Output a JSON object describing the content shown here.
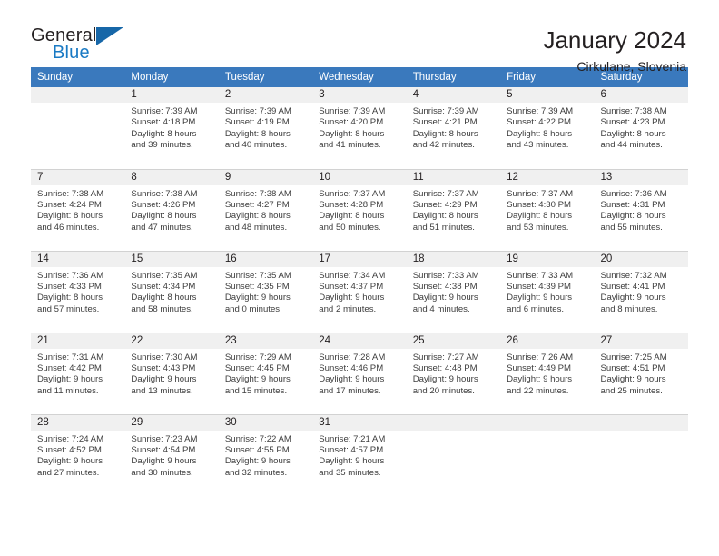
{
  "brand": {
    "name_part1": "General",
    "name_part2": "Blue",
    "accent_color": "#1a7ac4",
    "triangle_color": "#1767a8"
  },
  "header": {
    "title": "January 2024",
    "subtitle": "Cirkulane, Slovenia"
  },
  "calendar": {
    "header_bg": "#3a79bd",
    "daynum_bg": "#f0f0f0",
    "weekdays": [
      "Sunday",
      "Monday",
      "Tuesday",
      "Wednesday",
      "Thursday",
      "Friday",
      "Saturday"
    ],
    "weeks": [
      [
        {
          "day": "",
          "lines": []
        },
        {
          "day": "1",
          "lines": [
            "Sunrise: 7:39 AM",
            "Sunset: 4:18 PM",
            "Daylight: 8 hours",
            "and 39 minutes."
          ]
        },
        {
          "day": "2",
          "lines": [
            "Sunrise: 7:39 AM",
            "Sunset: 4:19 PM",
            "Daylight: 8 hours",
            "and 40 minutes."
          ]
        },
        {
          "day": "3",
          "lines": [
            "Sunrise: 7:39 AM",
            "Sunset: 4:20 PM",
            "Daylight: 8 hours",
            "and 41 minutes."
          ]
        },
        {
          "day": "4",
          "lines": [
            "Sunrise: 7:39 AM",
            "Sunset: 4:21 PM",
            "Daylight: 8 hours",
            "and 42 minutes."
          ]
        },
        {
          "day": "5",
          "lines": [
            "Sunrise: 7:39 AM",
            "Sunset: 4:22 PM",
            "Daylight: 8 hours",
            "and 43 minutes."
          ]
        },
        {
          "day": "6",
          "lines": [
            "Sunrise: 7:38 AM",
            "Sunset: 4:23 PM",
            "Daylight: 8 hours",
            "and 44 minutes."
          ]
        }
      ],
      [
        {
          "day": "7",
          "lines": [
            "Sunrise: 7:38 AM",
            "Sunset: 4:24 PM",
            "Daylight: 8 hours",
            "and 46 minutes."
          ]
        },
        {
          "day": "8",
          "lines": [
            "Sunrise: 7:38 AM",
            "Sunset: 4:26 PM",
            "Daylight: 8 hours",
            "and 47 minutes."
          ]
        },
        {
          "day": "9",
          "lines": [
            "Sunrise: 7:38 AM",
            "Sunset: 4:27 PM",
            "Daylight: 8 hours",
            "and 48 minutes."
          ]
        },
        {
          "day": "10",
          "lines": [
            "Sunrise: 7:37 AM",
            "Sunset: 4:28 PM",
            "Daylight: 8 hours",
            "and 50 minutes."
          ]
        },
        {
          "day": "11",
          "lines": [
            "Sunrise: 7:37 AM",
            "Sunset: 4:29 PM",
            "Daylight: 8 hours",
            "and 51 minutes."
          ]
        },
        {
          "day": "12",
          "lines": [
            "Sunrise: 7:37 AM",
            "Sunset: 4:30 PM",
            "Daylight: 8 hours",
            "and 53 minutes."
          ]
        },
        {
          "day": "13",
          "lines": [
            "Sunrise: 7:36 AM",
            "Sunset: 4:31 PM",
            "Daylight: 8 hours",
            "and 55 minutes."
          ]
        }
      ],
      [
        {
          "day": "14",
          "lines": [
            "Sunrise: 7:36 AM",
            "Sunset: 4:33 PM",
            "Daylight: 8 hours",
            "and 57 minutes."
          ]
        },
        {
          "day": "15",
          "lines": [
            "Sunrise: 7:35 AM",
            "Sunset: 4:34 PM",
            "Daylight: 8 hours",
            "and 58 minutes."
          ]
        },
        {
          "day": "16",
          "lines": [
            "Sunrise: 7:35 AM",
            "Sunset: 4:35 PM",
            "Daylight: 9 hours",
            "and 0 minutes."
          ]
        },
        {
          "day": "17",
          "lines": [
            "Sunrise: 7:34 AM",
            "Sunset: 4:37 PM",
            "Daylight: 9 hours",
            "and 2 minutes."
          ]
        },
        {
          "day": "18",
          "lines": [
            "Sunrise: 7:33 AM",
            "Sunset: 4:38 PM",
            "Daylight: 9 hours",
            "and 4 minutes."
          ]
        },
        {
          "day": "19",
          "lines": [
            "Sunrise: 7:33 AM",
            "Sunset: 4:39 PM",
            "Daylight: 9 hours",
            "and 6 minutes."
          ]
        },
        {
          "day": "20",
          "lines": [
            "Sunrise: 7:32 AM",
            "Sunset: 4:41 PM",
            "Daylight: 9 hours",
            "and 8 minutes."
          ]
        }
      ],
      [
        {
          "day": "21",
          "lines": [
            "Sunrise: 7:31 AM",
            "Sunset: 4:42 PM",
            "Daylight: 9 hours",
            "and 11 minutes."
          ]
        },
        {
          "day": "22",
          "lines": [
            "Sunrise: 7:30 AM",
            "Sunset: 4:43 PM",
            "Daylight: 9 hours",
            "and 13 minutes."
          ]
        },
        {
          "day": "23",
          "lines": [
            "Sunrise: 7:29 AM",
            "Sunset: 4:45 PM",
            "Daylight: 9 hours",
            "and 15 minutes."
          ]
        },
        {
          "day": "24",
          "lines": [
            "Sunrise: 7:28 AM",
            "Sunset: 4:46 PM",
            "Daylight: 9 hours",
            "and 17 minutes."
          ]
        },
        {
          "day": "25",
          "lines": [
            "Sunrise: 7:27 AM",
            "Sunset: 4:48 PM",
            "Daylight: 9 hours",
            "and 20 minutes."
          ]
        },
        {
          "day": "26",
          "lines": [
            "Sunrise: 7:26 AM",
            "Sunset: 4:49 PM",
            "Daylight: 9 hours",
            "and 22 minutes."
          ]
        },
        {
          "day": "27",
          "lines": [
            "Sunrise: 7:25 AM",
            "Sunset: 4:51 PM",
            "Daylight: 9 hours",
            "and 25 minutes."
          ]
        }
      ],
      [
        {
          "day": "28",
          "lines": [
            "Sunrise: 7:24 AM",
            "Sunset: 4:52 PM",
            "Daylight: 9 hours",
            "and 27 minutes."
          ]
        },
        {
          "day": "29",
          "lines": [
            "Sunrise: 7:23 AM",
            "Sunset: 4:54 PM",
            "Daylight: 9 hours",
            "and 30 minutes."
          ]
        },
        {
          "day": "30",
          "lines": [
            "Sunrise: 7:22 AM",
            "Sunset: 4:55 PM",
            "Daylight: 9 hours",
            "and 32 minutes."
          ]
        },
        {
          "day": "31",
          "lines": [
            "Sunrise: 7:21 AM",
            "Sunset: 4:57 PM",
            "Daylight: 9 hours",
            "and 35 minutes."
          ]
        },
        {
          "day": "",
          "lines": []
        },
        {
          "day": "",
          "lines": []
        },
        {
          "day": "",
          "lines": []
        }
      ]
    ]
  }
}
